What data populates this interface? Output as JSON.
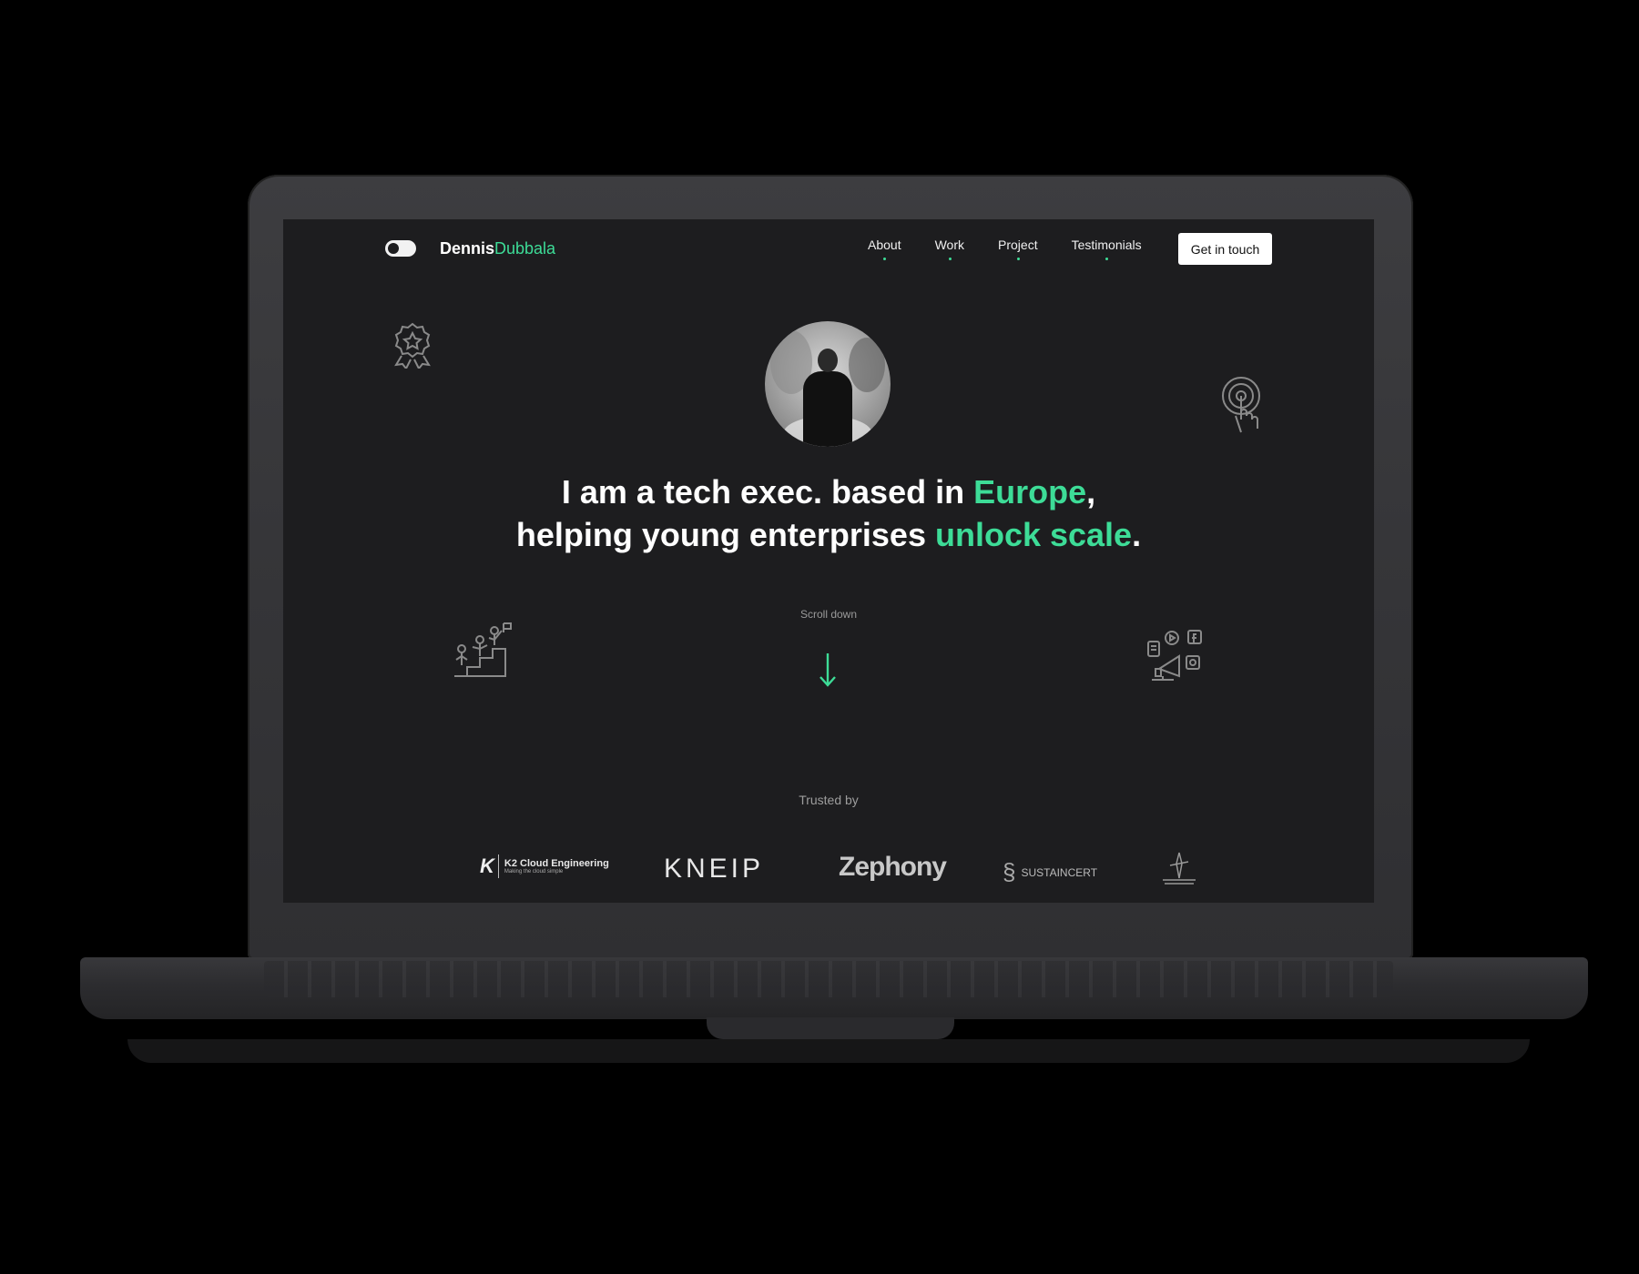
{
  "nav": {
    "brand_first": "Dennis",
    "brand_second": "Dubbala",
    "links": [
      "About",
      "Work",
      "Project",
      "Testimonials"
    ],
    "cta": "Get in touch"
  },
  "hero": {
    "line1_a": "I am a tech exec. based in ",
    "line1_accent": "Europe",
    "line1_b": ",",
    "line2_a": "helping young enterprises ",
    "line2_accent": "unlock scale",
    "line2_b": "."
  },
  "scroll": {
    "label": "Scroll down",
    "icon": "arrow-down-icon"
  },
  "trusted": {
    "label": "Trusted by",
    "logos": {
      "k2_mark": "K",
      "k2_name": "K2 Cloud Engineering",
      "k2_tagline": "Making the cloud simple",
      "kneip": "KNEIP",
      "zephony": "Zephony",
      "sustaincert": "SUSTAINCERT"
    }
  },
  "colors": {
    "accent": "#3ddc97",
    "background": "#1d1d1f"
  },
  "icons": [
    "toggle-icon",
    "award-badge-icon",
    "touch-target-icon",
    "team-climbing-icon",
    "marketing-megaphone-icon"
  ]
}
